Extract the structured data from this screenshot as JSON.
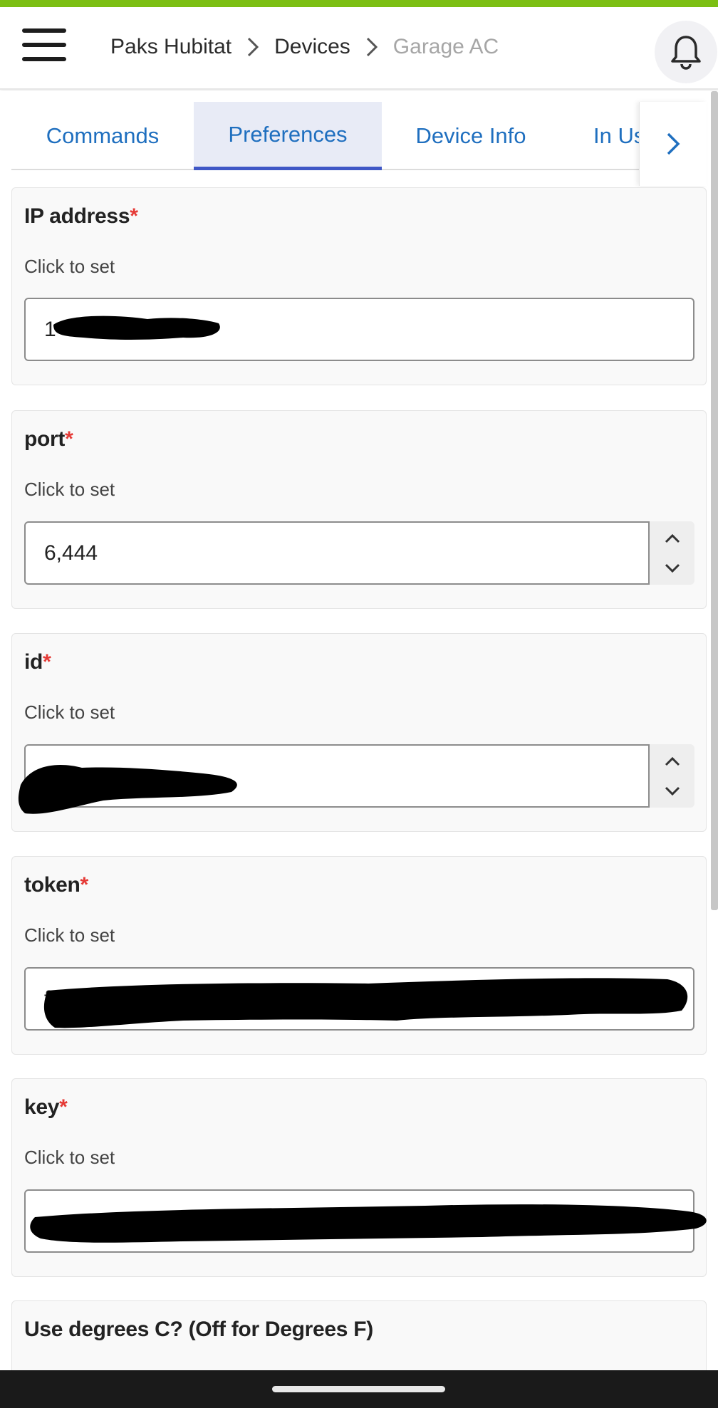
{
  "colors": {
    "accent_bar": "#7cbf13",
    "link": "#1f6fbf",
    "tab_active_bg": "#e8ebf6",
    "tab_active_underline": "#3f57c6",
    "required": "#e53935",
    "breadcrumb_current": "#a6a6a6"
  },
  "header": {
    "menu_icon": "hamburger-menu-icon",
    "breadcrumb": [
      {
        "label": "Paks Hubitat"
      },
      {
        "label": "Devices"
      },
      {
        "label": "Garage AC"
      }
    ],
    "separator_icon": "chevron-right-icon",
    "notification_icon": "bell-icon"
  },
  "tabs": {
    "items": [
      {
        "label": "Commands"
      },
      {
        "label": "Preferences",
        "active": true
      },
      {
        "label": "Device Info"
      },
      {
        "label": "In Use By"
      }
    ],
    "scroll_icon": "chevron-right-icon"
  },
  "preferences": [
    {
      "title": "IP address",
      "required_mark": "*",
      "hint": "Click to set",
      "value": "1",
      "redacted": true
    },
    {
      "title": "port",
      "required_mark": "*",
      "hint": "Click to set",
      "value": "6,444",
      "numeric": true
    },
    {
      "title": "id",
      "required_mark": "*",
      "hint": "Click to set",
      "value": "",
      "numeric": true,
      "redacted": true
    },
    {
      "title": "token",
      "required_mark": "*",
      "hint": "Click to set",
      "value": "f",
      "redacted": true
    },
    {
      "title": "key",
      "required_mark": "*",
      "hint": "Click to set",
      "value": "",
      "redacted": true
    },
    {
      "title": "Use degrees C? (Off for Degrees F)"
    }
  ],
  "stepper_icons": {
    "up": "chevron-up-icon",
    "down": "chevron-down-icon"
  }
}
